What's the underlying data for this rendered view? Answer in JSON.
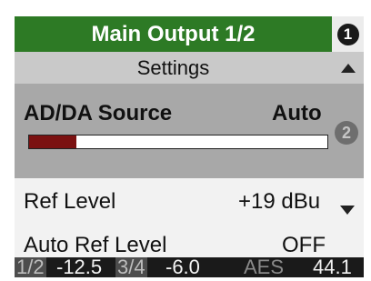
{
  "header": {
    "title": "Main Output 1/2",
    "badge": "1"
  },
  "settings": {
    "label": "Settings"
  },
  "selected_row": {
    "label": "AD/DA Source",
    "value": "Auto",
    "meter_level": 0.16,
    "badge": "2"
  },
  "rows": [
    {
      "label": "Ref Level",
      "value": "+19 dBu"
    },
    {
      "label": "Auto Ref Level",
      "value": "OFF"
    }
  ],
  "footer": {
    "ch1_label": "1/2",
    "ch1_value": "-12.5",
    "ch2_label": "3/4",
    "ch2_value": "-6.0",
    "sync_label": "AES",
    "sync_value": "44.1"
  },
  "colors": {
    "title_bg": "#2d7a25",
    "meter_fill": "#7b1111"
  }
}
